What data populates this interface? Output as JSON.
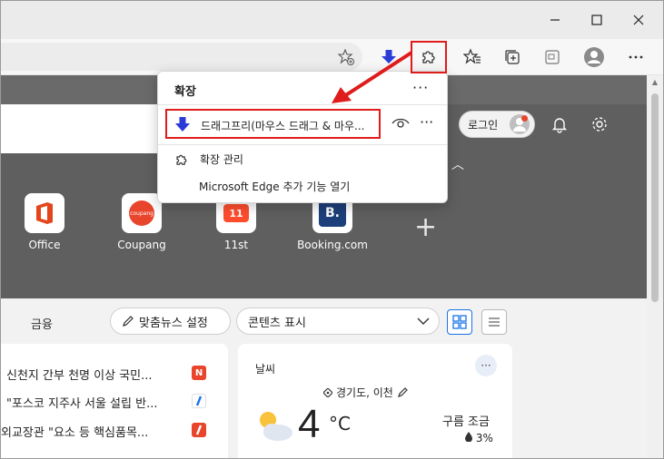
{
  "popup": {
    "title": "확장",
    "more_label": "···",
    "extension_name": "드래그프리(마우스 드래그 & 마우...",
    "manage_label": "확장 관리",
    "store_label": "Microsoft Edge 추가 기능 열기"
  },
  "header": {
    "login_label": "로그인"
  },
  "tiles": [
    {
      "label": "Office"
    },
    {
      "label": "Coupang",
      "logo_text": "coupang"
    },
    {
      "label": "11st",
      "logo_text": "11"
    },
    {
      "label": "Booking.com",
      "logo_text": "B."
    }
  ],
  "feed": {
    "nav_text": "금융",
    "personalize_label": "맞춤뉴스 설정",
    "content_dropdown": "콘텐츠 표시"
  },
  "news": [
    {
      "text": "신천지 간부 천명 이상 국민...",
      "badge": "N",
      "badge_color": "#e8452c"
    },
    {
      "text": "\"포스코 지주사 서울 설립 반...",
      "badge": "",
      "badge_color": "#1a73e8"
    },
    {
      "text": "외교장관 \"요소 등 핵심품목...",
      "badge": "",
      "badge_color": "#e8452c"
    }
  ],
  "weather": {
    "title": "날씨",
    "more": "···",
    "location": "경기도, 이천",
    "temperature": "4",
    "unit": "°C",
    "condition": "구름 조금",
    "rain": "3%"
  },
  "colors": {
    "accent": "#e01b1b",
    "dark_bg": "#5f5f5f",
    "extension_arrow": "#2b3bd6"
  }
}
